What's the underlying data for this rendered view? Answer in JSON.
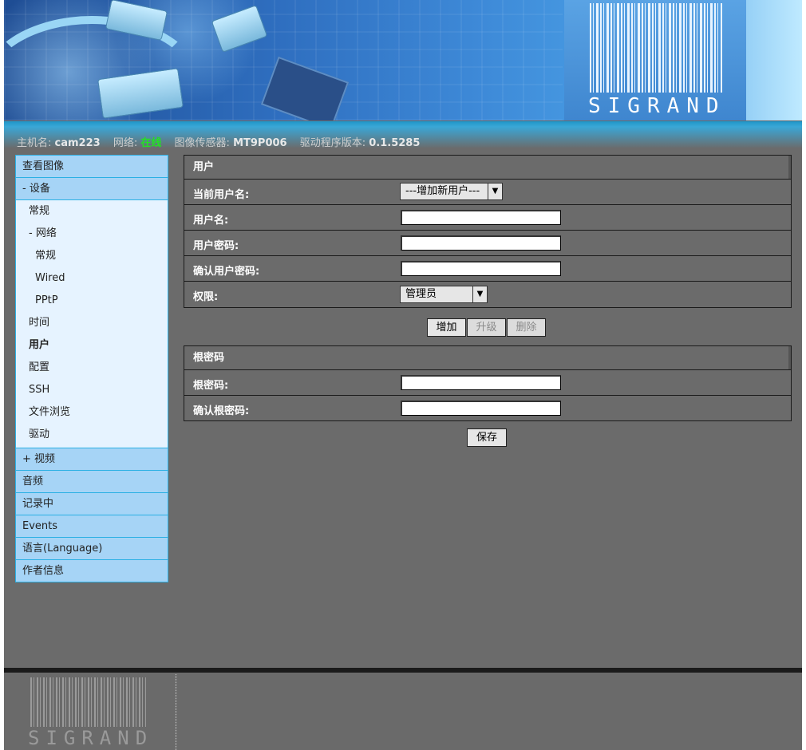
{
  "header": {
    "logo_text": "SIGRAND"
  },
  "status": {
    "hostname_label": "主机名:",
    "hostname": "cam223",
    "network_label": "网络:",
    "network_state": "在线",
    "sensor_label": "图像传感器:",
    "sensor": "MT9P006",
    "driver_label": "驱动程序版本:",
    "driver_version": "0.1.5285"
  },
  "sidebar": {
    "view_image": "查看图像",
    "device": "- 设备",
    "general": "常规",
    "network": "- 网络",
    "network_general": "常规",
    "wired": "Wired",
    "pptp": "PPtP",
    "time": "时间",
    "user": "用户",
    "config": "配置",
    "ssh": "SSH",
    "file_browse": "文件浏览",
    "driver": "驱动",
    "video": "+ 视频",
    "audio": "音频",
    "recording": "记录中",
    "events": "Events",
    "language": "语言(Language)",
    "author": "作者信息"
  },
  "user_panel": {
    "title": "用户",
    "current_user_label": "当前用户名:",
    "current_user_value": "---增加新用户---",
    "username_label": "用户名:",
    "password_label": "用户密码:",
    "confirm_password_label": "确认用户密码:",
    "permission_label": "权限:",
    "permission_value": "管理员",
    "add_button": "增加",
    "upgrade_button": "升级",
    "delete_button": "删除"
  },
  "root_panel": {
    "title": "根密码",
    "root_password_label": "根密码:",
    "confirm_root_label": "确认根密码:",
    "save_button": "保存"
  },
  "footer": {
    "logo_text": "SIGRAND"
  },
  "colors": {
    "accent": "#2bb0e4",
    "online": "#24e024",
    "background": "#6b6b6b"
  }
}
